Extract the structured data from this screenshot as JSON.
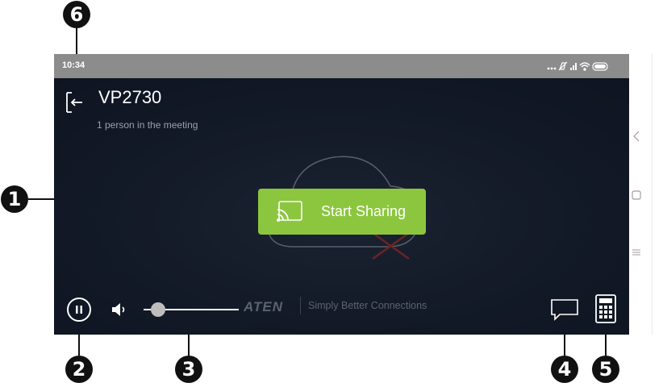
{
  "status_bar": {
    "time": "10:34",
    "status_icons": [
      "more-dots-icon",
      "mute-icon",
      "signal-icon",
      "wifi-icon",
      "battery-icon"
    ]
  },
  "meeting": {
    "title": "VP2730",
    "participants": "1 person in the meeting",
    "back_icon": "exit-icon"
  },
  "share": {
    "label": "Start Sharing",
    "icon": "cast-icon",
    "color": "#8cc63f"
  },
  "controls": {
    "pause_icon": "pause-icon",
    "volume_icon": "speaker-icon",
    "volume_level": 0.13,
    "chat_icon": "chat-icon",
    "keypad_icon": "keypad-icon"
  },
  "brand": {
    "logo": "ATEN",
    "tagline": "Simply Better Connections"
  },
  "nav": {
    "icons": [
      "back-chevron-icon",
      "home-square-icon",
      "menu-lines-icon"
    ]
  },
  "callouts": [
    "1",
    "2",
    "3",
    "4",
    "5",
    "6"
  ],
  "colors": {
    "status_bar": "#8c8c8c",
    "screen_bg": "#141b29",
    "callout": "#111111"
  }
}
